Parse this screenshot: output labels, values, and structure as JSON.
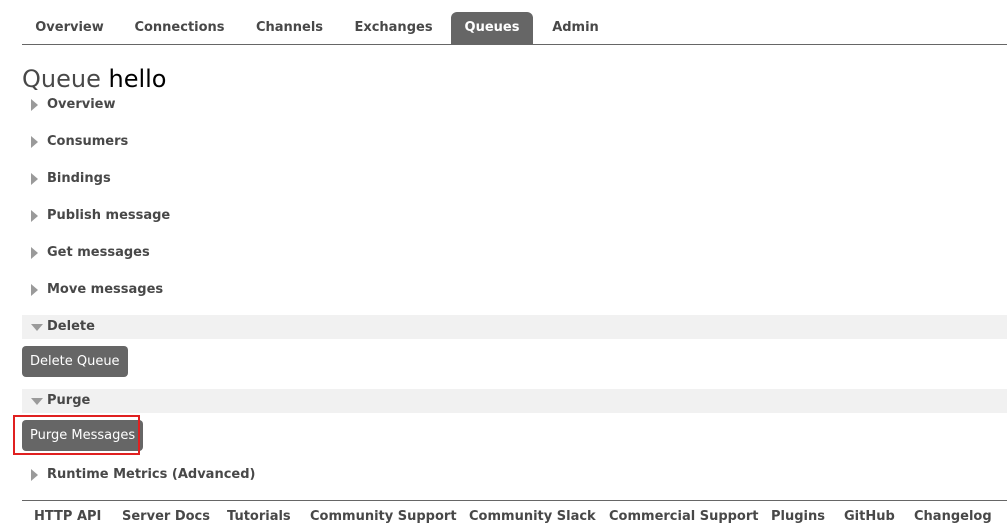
{
  "nav": {
    "tabs": [
      {
        "label": "Overview",
        "active": false
      },
      {
        "label": "Connections",
        "active": false
      },
      {
        "label": "Channels",
        "active": false
      },
      {
        "label": "Exchanges",
        "active": false
      },
      {
        "label": "Queues",
        "active": true
      },
      {
        "label": "Admin",
        "active": false
      }
    ]
  },
  "page": {
    "title_prefix": "Queue",
    "queue_name": "hello"
  },
  "sections": [
    {
      "label": "Overview",
      "expanded": false
    },
    {
      "label": "Consumers",
      "expanded": false
    },
    {
      "label": "Bindings",
      "expanded": false
    },
    {
      "label": "Publish message",
      "expanded": false
    },
    {
      "label": "Get messages",
      "expanded": false
    },
    {
      "label": "Move messages",
      "expanded": false
    },
    {
      "label": "Delete",
      "expanded": true
    },
    {
      "label": "Purge",
      "expanded": true
    },
    {
      "label": "Runtime Metrics (Advanced)",
      "expanded": false
    }
  ],
  "buttons": {
    "delete_queue": "Delete Queue",
    "purge_messages": "Purge Messages"
  },
  "footer": {
    "links": [
      "HTTP API",
      "Server Docs",
      "Tutorials",
      "Community Support",
      "Community Slack",
      "Commercial Support",
      "Plugins",
      "GitHub",
      "Changelog"
    ]
  },
  "colors": {
    "tab_active_bg": "#666666",
    "button_bg": "#666666",
    "section_expanded_bg": "#f1f1f1",
    "highlight_border": "#e02020",
    "text": "#484848"
  },
  "icons": {
    "collapsed": "triangle-right-icon",
    "expanded": "triangle-down-icon"
  }
}
